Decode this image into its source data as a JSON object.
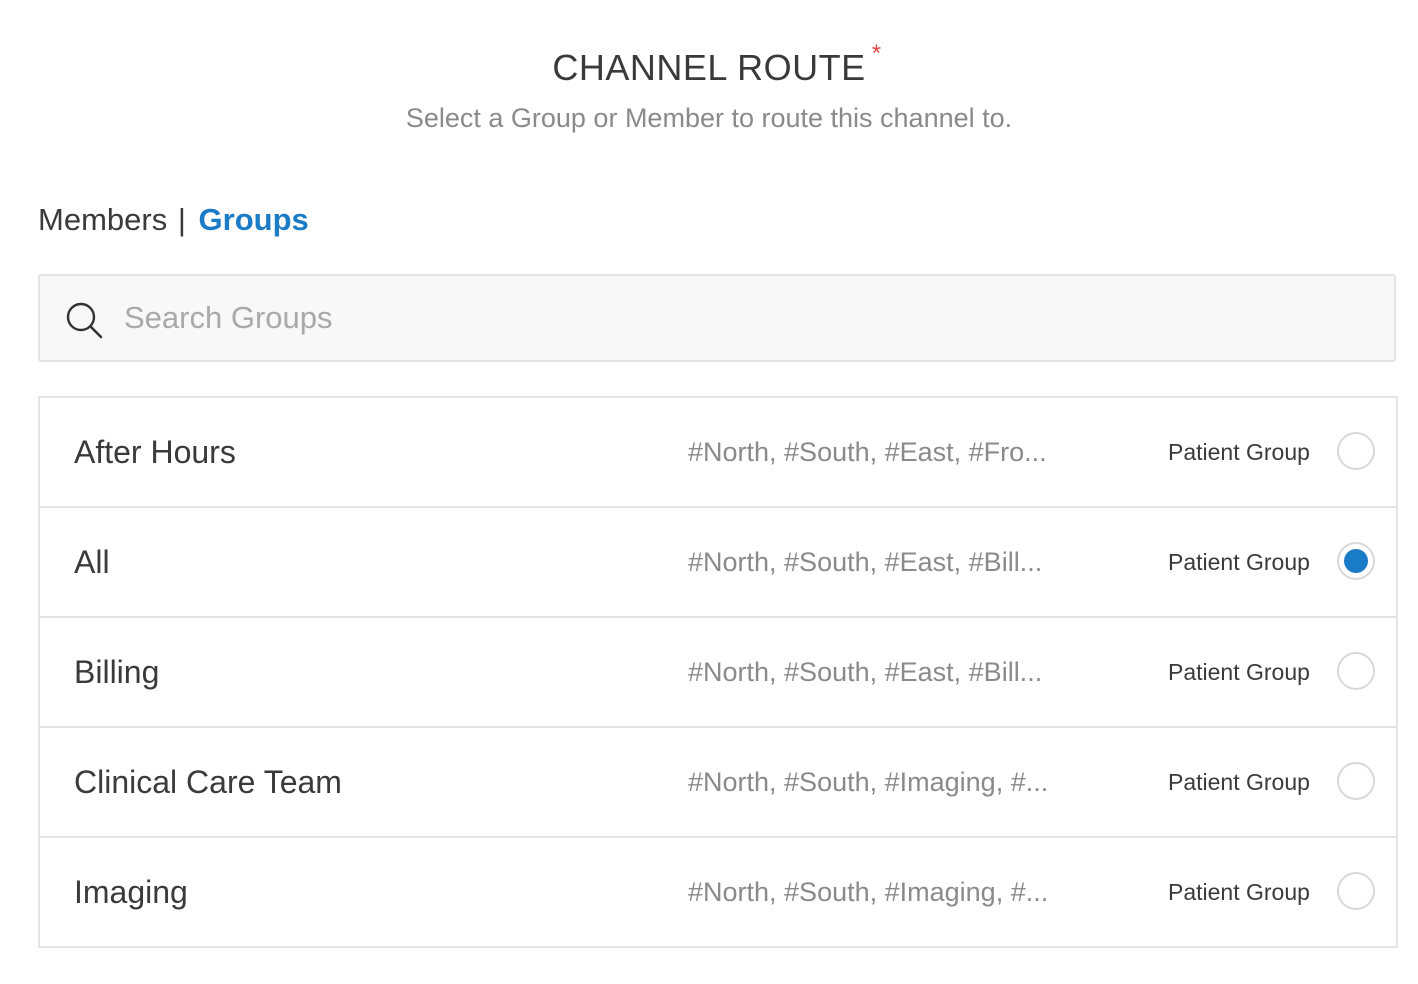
{
  "header": {
    "title": "CHANNEL ROUTE",
    "required_marker": "*",
    "subtitle": "Select a Group or Member to route this channel to."
  },
  "toggle": {
    "members_label": "Members",
    "separator": "|",
    "groups_label": "Groups",
    "active": "Groups"
  },
  "search": {
    "placeholder": "Search Groups",
    "value": "",
    "icon": "search-icon"
  },
  "colors": {
    "accent": "#1a7bc6",
    "required": "#e04a3f",
    "border": "#e4e4e4"
  },
  "groups": [
    {
      "name": "After Hours",
      "tags": "#North, #South, #East, #Fro...",
      "type": "Patient Group",
      "selected": false
    },
    {
      "name": "All",
      "tags": "#North, #South, #East, #Bill...",
      "type": "Patient Group",
      "selected": true
    },
    {
      "name": "Billing",
      "tags": "#North, #South, #East, #Bill...",
      "type": "Patient Group",
      "selected": false
    },
    {
      "name": "Clinical Care Team",
      "tags": "#North, #South, #Imaging, #...",
      "type": "Patient Group",
      "selected": false
    },
    {
      "name": "Imaging",
      "tags": "#North, #South, #Imaging, #...",
      "type": "Patient Group",
      "selected": false
    }
  ]
}
